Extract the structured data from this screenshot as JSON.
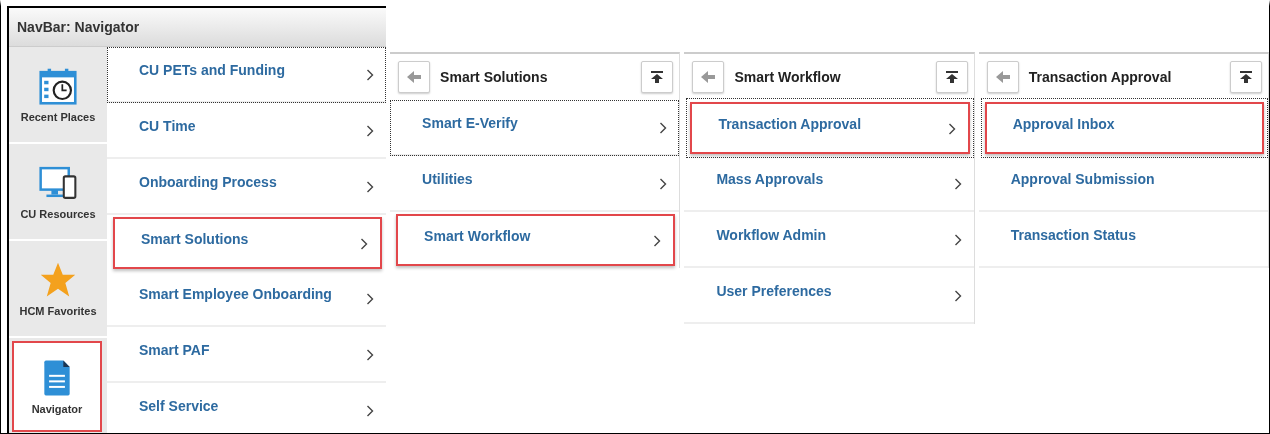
{
  "navbar": {
    "title": "NavBar: Navigator",
    "tiles": [
      {
        "label": "Recent Places",
        "kind": "calendar",
        "selected": false
      },
      {
        "label": "CU Resources",
        "kind": "devices",
        "selected": false
      },
      {
        "label": "HCM Favorites",
        "kind": "star",
        "selected": false
      },
      {
        "label": "Navigator",
        "kind": "document",
        "selected": true
      }
    ],
    "items": [
      {
        "label": "CU PETs and Funding",
        "focused": true,
        "highlighted": false
      },
      {
        "label": "CU Time",
        "focused": false,
        "highlighted": false
      },
      {
        "label": "Onboarding Process",
        "focused": false,
        "highlighted": false
      },
      {
        "label": "Smart Solutions",
        "focused": false,
        "highlighted": true
      },
      {
        "label": "Smart Employee Onboarding",
        "focused": false,
        "highlighted": false
      },
      {
        "label": "Smart PAF",
        "focused": false,
        "highlighted": false
      },
      {
        "label": "Self Service",
        "focused": false,
        "highlighted": false
      }
    ]
  },
  "panels": [
    {
      "title": "Smart Solutions",
      "items": [
        {
          "label": "Smart E-Verify",
          "focused": true,
          "highlighted": false,
          "folder": true
        },
        {
          "label": "Utilities",
          "focused": false,
          "highlighted": false,
          "folder": true
        },
        {
          "label": "Smart Workflow",
          "focused": false,
          "highlighted": true,
          "folder": true
        }
      ]
    },
    {
      "title": "Smart Workflow",
      "items": [
        {
          "label": "Transaction Approval",
          "focused": true,
          "highlighted": true,
          "folder": true
        },
        {
          "label": "Mass Approvals",
          "focused": false,
          "highlighted": false,
          "folder": true
        },
        {
          "label": "Workflow Admin",
          "focused": false,
          "highlighted": false,
          "folder": true
        },
        {
          "label": "User Preferences",
          "focused": false,
          "highlighted": false,
          "folder": true
        }
      ]
    },
    {
      "title": "Transaction Approval",
      "items": [
        {
          "label": "Approval Inbox",
          "focused": true,
          "highlighted": true,
          "folder": false
        },
        {
          "label": "Approval Submission",
          "focused": false,
          "highlighted": false,
          "folder": false
        },
        {
          "label": "Transaction Status",
          "focused": false,
          "highlighted": false,
          "folder": false
        }
      ]
    }
  ]
}
